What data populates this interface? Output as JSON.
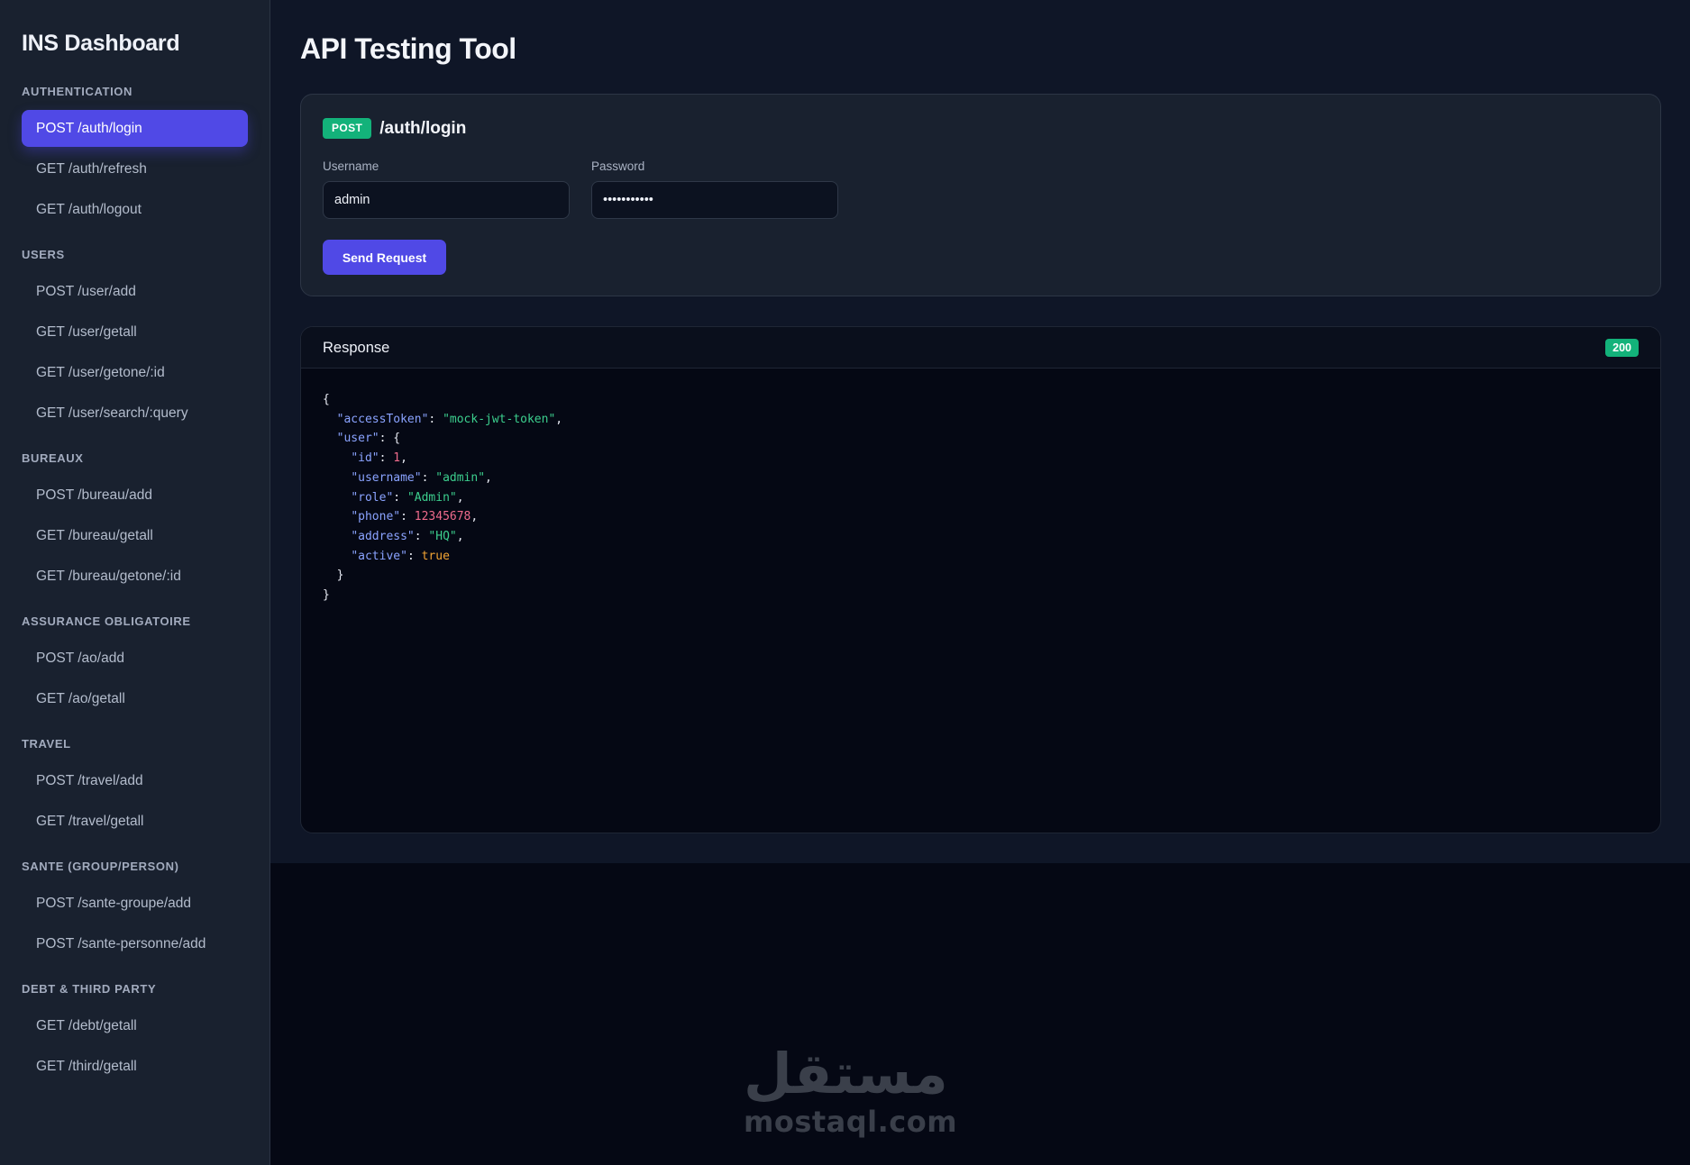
{
  "sidebar": {
    "brand": "INS Dashboard",
    "groups": [
      {
        "label": "AUTHENTICATION",
        "items": [
          "POST /auth/login",
          "GET /auth/refresh",
          "GET /auth/logout"
        ]
      },
      {
        "label": "USERS",
        "items": [
          "POST /user/add",
          "GET /user/getall",
          "GET /user/getone/:id",
          "GET /user/search/:query"
        ]
      },
      {
        "label": "BUREAUX",
        "items": [
          "POST /bureau/add",
          "GET /bureau/getall",
          "GET /bureau/getone/:id"
        ]
      },
      {
        "label": "ASSURANCE OBLIGATOIRE",
        "items": [
          "POST /ao/add",
          "GET /ao/getall"
        ]
      },
      {
        "label": "TRAVEL",
        "items": [
          "POST /travel/add",
          "GET /travel/getall"
        ]
      },
      {
        "label": "SANTE (GROUP/PERSON)",
        "items": [
          "POST /sante-groupe/add",
          "POST /sante-personne/add"
        ]
      },
      {
        "label": "DEBT & THIRD PARTY",
        "items": [
          "GET /debt/getall",
          "GET /third/getall"
        ]
      }
    ]
  },
  "main": {
    "title": "API Testing Tool",
    "request": {
      "method": "POST",
      "path": "/auth/login",
      "username_label": "Username",
      "username_value": "admin",
      "password_label": "Password",
      "password_value": "admin123456",
      "send_label": "Send Request"
    },
    "response": {
      "title": "Response",
      "status": "200",
      "body": {
        "accessToken": "mock-jwt-token",
        "user": {
          "id": 1,
          "username": "admin",
          "role": "Admin",
          "phone": 12345678,
          "address": "HQ",
          "active": true
        }
      }
    }
  },
  "watermark": {
    "arabic": "مستقل",
    "latin": "mostaql.com"
  },
  "colors": {
    "accent": "#5049e6",
    "success": "#13b27a",
    "sidebar_bg": "#19212f",
    "main_bg": "#0f1627",
    "json_key": "#8aa3ff",
    "json_string": "#3ccf8e",
    "json_number": "#f06b8c",
    "json_boolean": "#f4a534"
  },
  "active_item": "POST /auth/login"
}
